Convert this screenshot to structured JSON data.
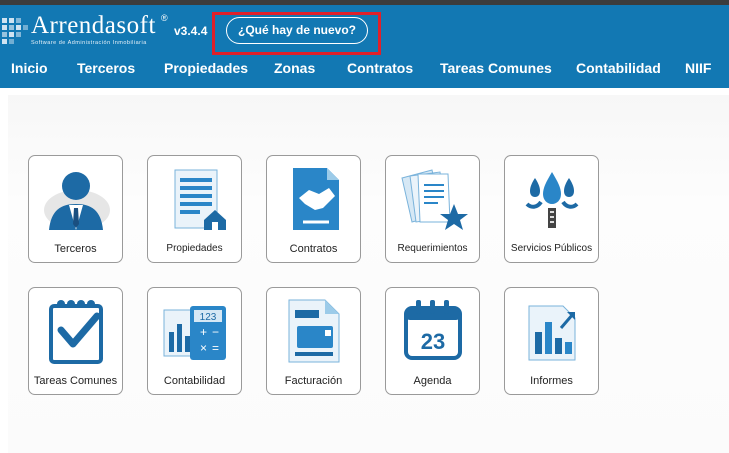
{
  "header": {
    "brand": "Arrendasoft",
    "brand_mark": "®",
    "brand_subtitle": "Software de Administración Inmobiliaria",
    "version": "v3.4.4",
    "whats_new": "¿Qué hay de nuevo?",
    "colors": {
      "bar": "#1278b3",
      "highlight": "#e0202a"
    }
  },
  "nav": {
    "items": [
      "Inicio",
      "Terceros",
      "Propiedades",
      "Zonas",
      "Contratos",
      "Tareas Comunes",
      "Contabilidad",
      "NIIF"
    ]
  },
  "tiles": [
    {
      "label": "Terceros",
      "icon": "user-icon"
    },
    {
      "label": "Propiedades",
      "icon": "property-icon"
    },
    {
      "label": "Contratos",
      "icon": "handshake-icon"
    },
    {
      "label": "Requerimientos",
      "icon": "documents-star-icon"
    },
    {
      "label": "Servicios Públicos",
      "icon": "water-meter-icon"
    },
    {
      "label": "Tareas Comunes",
      "icon": "checklist-icon"
    },
    {
      "label": "Contabilidad",
      "icon": "calculator-chart-icon"
    },
    {
      "label": "Facturación",
      "icon": "invoice-icon"
    },
    {
      "label": "Agenda",
      "icon": "calendar-icon"
    },
    {
      "label": "Informes",
      "icon": "report-chart-icon"
    }
  ],
  "calendar_day": "23"
}
